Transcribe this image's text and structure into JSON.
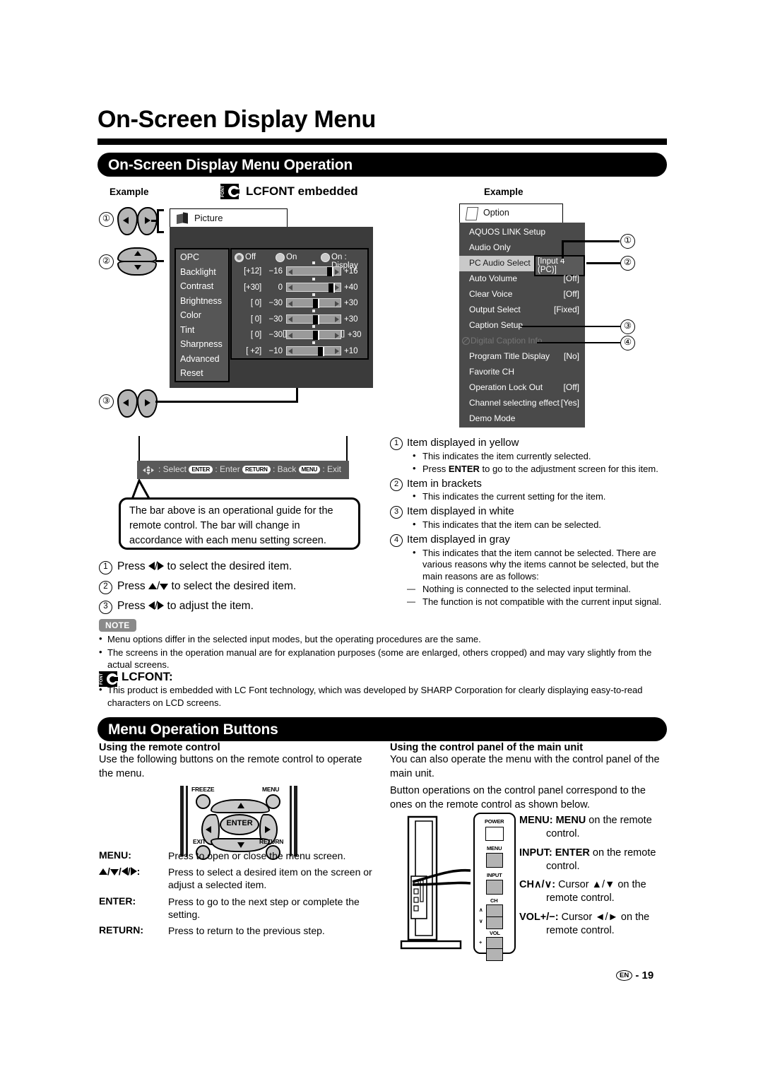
{
  "page": {
    "title": "On-Screen Display Menu",
    "footer_region": "EN",
    "footer_page": "19",
    "footer_sep": "-"
  },
  "sections": {
    "operation_band": "On-Screen Display Menu Operation",
    "buttons_band": "Menu Operation Buttons"
  },
  "labels": {
    "example_left": "Example",
    "example_right": "Example",
    "lcfont_embedded": "LCFONT embedded",
    "lcfont_heading": "LCFONT:",
    "font_icon_text": "FONT"
  },
  "picture_menu": {
    "tab_label": "Picture",
    "tab_icon": "picture-icon",
    "items": [
      "OPC",
      "Backlight",
      "Contrast",
      "Brightness",
      "Color",
      "Tint",
      "Sharpness",
      "Advanced",
      "Reset"
    ],
    "opc_options": [
      "Off",
      "On",
      "On : Display"
    ],
    "opc_selected": "Off",
    "sliders": [
      {
        "name": "Backlight",
        "value": "[+12]",
        "min": "−16",
        "max": "+16",
        "pos": 84,
        "brackets": false
      },
      {
        "name": "Contrast",
        "value": "[+30]",
        "min": "0",
        "max": "+40",
        "pos": 88,
        "brackets": false
      },
      {
        "name": "Brightness",
        "value": "[  0]",
        "min": "−30",
        "max": "+30",
        "pos": 50,
        "brackets": false
      },
      {
        "name": "Color",
        "value": "[  0]",
        "min": "−30",
        "max": "+30",
        "pos": 50,
        "brackets": false
      },
      {
        "name": "Tint",
        "value": "[  0]",
        "min": "−30",
        "max": "+30",
        "pos": 50,
        "brackets": true
      },
      {
        "name": "Sharpness",
        "value": "[ +2]",
        "min": "−10",
        "max": "+10",
        "pos": 62,
        "brackets": false
      }
    ]
  },
  "guide_bar": {
    "select": ": Select",
    "enter_key": "ENTER",
    "enter_text": ": Enter",
    "return_key": "RETURN",
    "return_text": ": Back",
    "menu_key": "MENU",
    "menu_text": ": Exit"
  },
  "balloon": {
    "text": "The bar above is an operational guide for the remote control. The bar will change in accordance with each menu setting screen."
  },
  "option_menu": {
    "tab_label": "Option",
    "tab_icon": "option-icon",
    "rows": [
      {
        "name": "AQUOS LINK Setup",
        "value": "",
        "state": "normal"
      },
      {
        "name": "Audio Only",
        "value": "",
        "state": "normal"
      },
      {
        "name": "PC Audio Select",
        "value": "[Input 4 (PC)]",
        "state": "selected"
      },
      {
        "name": "Auto Volume",
        "value": "[Off]",
        "state": "normal"
      },
      {
        "name": "Clear Voice",
        "value": "[Off]",
        "state": "normal"
      },
      {
        "name": "Output Select",
        "value": "[Fixed]",
        "state": "normal"
      },
      {
        "name": "Caption Setup",
        "value": "",
        "state": "normal"
      },
      {
        "name": "Digital Caption Info.",
        "value": "",
        "state": "dim"
      },
      {
        "name": "Program Title Display",
        "value": "[No]",
        "state": "normal"
      },
      {
        "name": "Favorite CH",
        "value": "",
        "state": "normal"
      },
      {
        "name": "Operation Lock Out",
        "value": "[Off]",
        "state": "normal"
      },
      {
        "name": "Channel selecting effect",
        "value": "[Yes]",
        "state": "normal"
      },
      {
        "name": "Demo Mode",
        "value": "",
        "state": "normal"
      }
    ],
    "callouts": [
      "1",
      "2",
      "3",
      "4"
    ]
  },
  "explanations": [
    {
      "num": "1",
      "head": "Item displayed in yellow",
      "bullets": [
        "This indicates the item currently selected.",
        "Press ENTER to go to the adjustment screen for this item."
      ],
      "dashes": []
    },
    {
      "num": "2",
      "head": "Item in brackets",
      "bullets": [
        "This indicates the current setting for the item."
      ],
      "dashes": []
    },
    {
      "num": "3",
      "head": "Item displayed in white",
      "bullets": [
        "This indicates that the item can be selected."
      ],
      "dashes": []
    },
    {
      "num": "4",
      "head": "Item displayed in gray",
      "bullets": [
        "This indicates that the item cannot be selected. There are various reasons why the items cannot be selected, but the main reasons are as follows:"
      ],
      "dashes": [
        "Nothing is connected to the selected input terminal.",
        "The function is not compatible with the current input signal."
      ]
    }
  ],
  "steps": [
    {
      "num": "1",
      "pre": "Press ",
      "arrows": "left-right",
      "post": " to select the desired item."
    },
    {
      "num": "2",
      "pre": "Press ",
      "arrows": "up-down",
      "post": " to select the desired item."
    },
    {
      "num": "3",
      "pre": "Press ",
      "arrows": "left-right",
      "post": " to adjust the item."
    }
  ],
  "note": {
    "badge": "NOTE",
    "items": [
      "Menu options differ in the selected input modes, but the operating procedures are the same.",
      "The screens in the operation manual are for explanation purposes (some are enlarged, others cropped) and may vary slightly from the actual screens."
    ],
    "lcfont_text": "This product is embedded with LC Font technology, which was developed by SHARP Corporation for clearly displaying easy-to-read characters on LCD screens."
  },
  "remote_section": {
    "heading": "Using the remote control",
    "body": "Use the following buttons on the remote control to operate the menu.",
    "remote_buttons": {
      "freeze": "FREEZE",
      "menu": "MENU",
      "exit": "EXIT",
      "return": "RETURN",
      "enter": "ENTER"
    },
    "key_table": [
      {
        "key": "MENU:",
        "desc": "Press to open or close the menu screen."
      },
      {
        "key": "ARROWS",
        "desc": "Press to select a desired item on the screen or adjust a selected item."
      },
      {
        "key": "ENTER:",
        "desc": "Press to go to the next step or complete the setting."
      },
      {
        "key": "RETURN:",
        "desc": "Press to return to the previous step."
      }
    ]
  },
  "panel_section": {
    "heading": "Using the control panel of the main unit",
    "body1": "You can also operate the menu with the control panel of the main unit.",
    "body2": "Button operations on the control panel correspond to the ones on the remote control as shown below.",
    "panel_labels": {
      "power": "POWER",
      "menu": "MENU",
      "input": "INPUT",
      "ch": "CH",
      "vol": "VOL",
      "ch_up": "∧",
      "ch_down": "∨",
      "vol_plus": "+",
      "vol_minus": "−"
    },
    "mappings": [
      {
        "lhs_bold": "MENU:",
        "rhs_bold": "MENU",
        "rest": " on the remote",
        "indent": "control."
      },
      {
        "lhs_bold": "INPUT:",
        "rhs_bold": "ENTER",
        "rest": " on the remote",
        "indent": "control."
      },
      {
        "lhs_bold": "CH∧/∨:",
        "rhs_bold": "",
        "rest": "Cursor ▲/▼ on the",
        "indent": "remote control."
      },
      {
        "lhs_bold": "VOL+/−:",
        "rhs_bold": "",
        "rest": "Cursor ◄/► on the",
        "indent": "remote control."
      }
    ]
  },
  "colors": {
    "osd_bg": "#4a4a4a",
    "osd_bg_dark": "#3b3b3b",
    "osd_sidebar": "#565656",
    "selected_row": "#c9c9c9",
    "guide_bar": "#595959",
    "note_badge": "#8a8a8a"
  }
}
